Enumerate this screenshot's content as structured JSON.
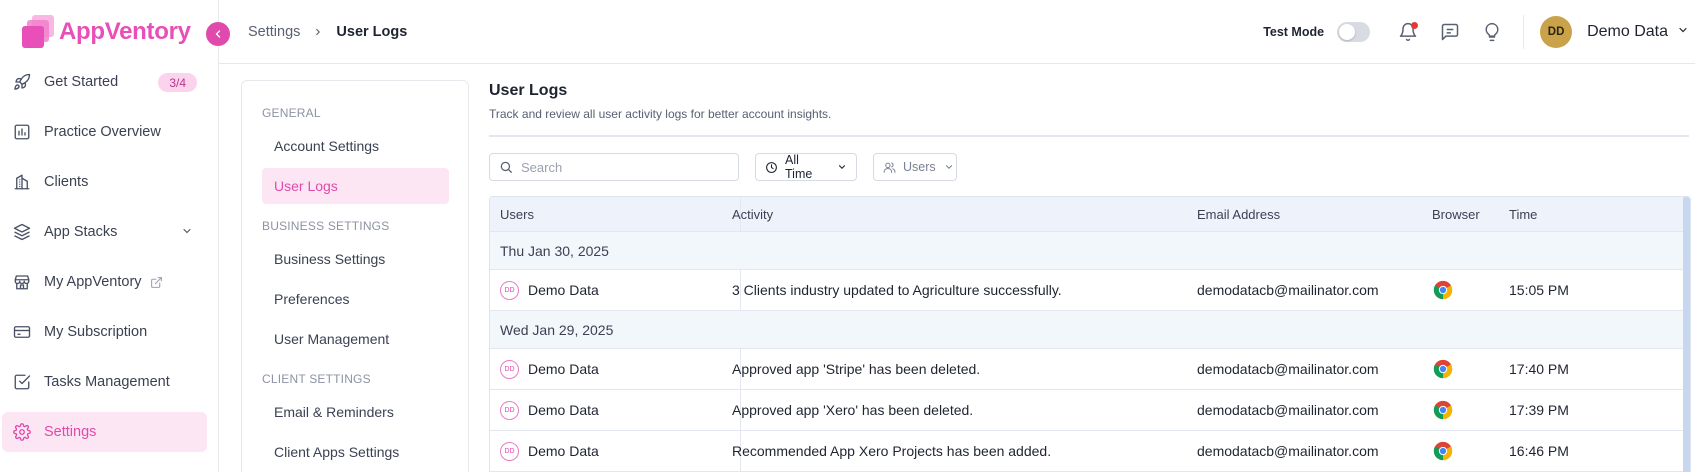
{
  "brand": {
    "name": "AppVentory",
    "color": "#e84fb8"
  },
  "sidebar": {
    "items": [
      {
        "label": "Get Started",
        "icon": "rocket-icon",
        "badge": "3/4"
      },
      {
        "label": "Practice Overview",
        "icon": "bar-chart-icon"
      },
      {
        "label": "Clients",
        "icon": "building-icon"
      },
      {
        "label": "App Stacks",
        "icon": "layers-icon"
      },
      {
        "label": "My AppVentory",
        "icon": "store-icon"
      },
      {
        "label": "My Subscription",
        "icon": "credit-card-icon"
      },
      {
        "label": "Tasks Management",
        "icon": "checkbox-icon"
      },
      {
        "label": "Settings",
        "icon": "gear-icon",
        "active": true
      }
    ]
  },
  "header": {
    "breadcrumb": [
      "Settings",
      "User Logs"
    ],
    "test_mode_label": "Test Mode",
    "test_mode_on": false,
    "user_initials": "DD",
    "user_name": "Demo Data"
  },
  "settings_nav": {
    "groups": [
      {
        "title": "GENERAL",
        "items": [
          "Account Settings",
          "User Logs"
        ]
      },
      {
        "title": "BUSINESS SETTINGS",
        "items": [
          "Business Settings",
          "Preferences",
          "User Management"
        ]
      },
      {
        "title": "CLIENT SETTINGS",
        "items": [
          "Email & Reminders",
          "Client Apps Settings"
        ]
      }
    ],
    "active": "User Logs"
  },
  "main": {
    "title": "User Logs",
    "subtitle": "Track and review all user activity logs for better account insights.",
    "search_placeholder": "Search",
    "time_filter": "All Time",
    "users_filter": "Users",
    "columns": [
      "Users",
      "Activity",
      "Email Address",
      "Browser",
      "Time"
    ],
    "rows": [
      {
        "type": "date",
        "label": "Thu Jan 30, 2025"
      },
      {
        "type": "log",
        "initials": "DD",
        "user": "Demo Data",
        "activity": "3 Clients industry updated to Agriculture successfully.",
        "email": "demodatacb@mailinator.com",
        "browser": "chrome-icon",
        "time": "15:05 PM"
      },
      {
        "type": "date",
        "label": "Wed Jan 29, 2025"
      },
      {
        "type": "log",
        "initials": "DD",
        "user": "Demo Data",
        "activity": "Approved app 'Stripe' has been deleted.",
        "email": "demodatacb@mailinator.com",
        "browser": "chrome-icon",
        "time": "17:40 PM"
      },
      {
        "type": "log",
        "initials": "DD",
        "user": "Demo Data",
        "activity": "Approved app 'Xero' has been deleted.",
        "email": "demodatacb@mailinator.com",
        "browser": "chrome-icon",
        "time": "17:39 PM"
      },
      {
        "type": "log",
        "initials": "DD",
        "user": "Demo Data",
        "activity": "Recommended App Xero Projects has been added.",
        "email": "demodatacb@mailinator.com",
        "browser": "chrome-icon",
        "time": "16:46 PM"
      }
    ]
  }
}
